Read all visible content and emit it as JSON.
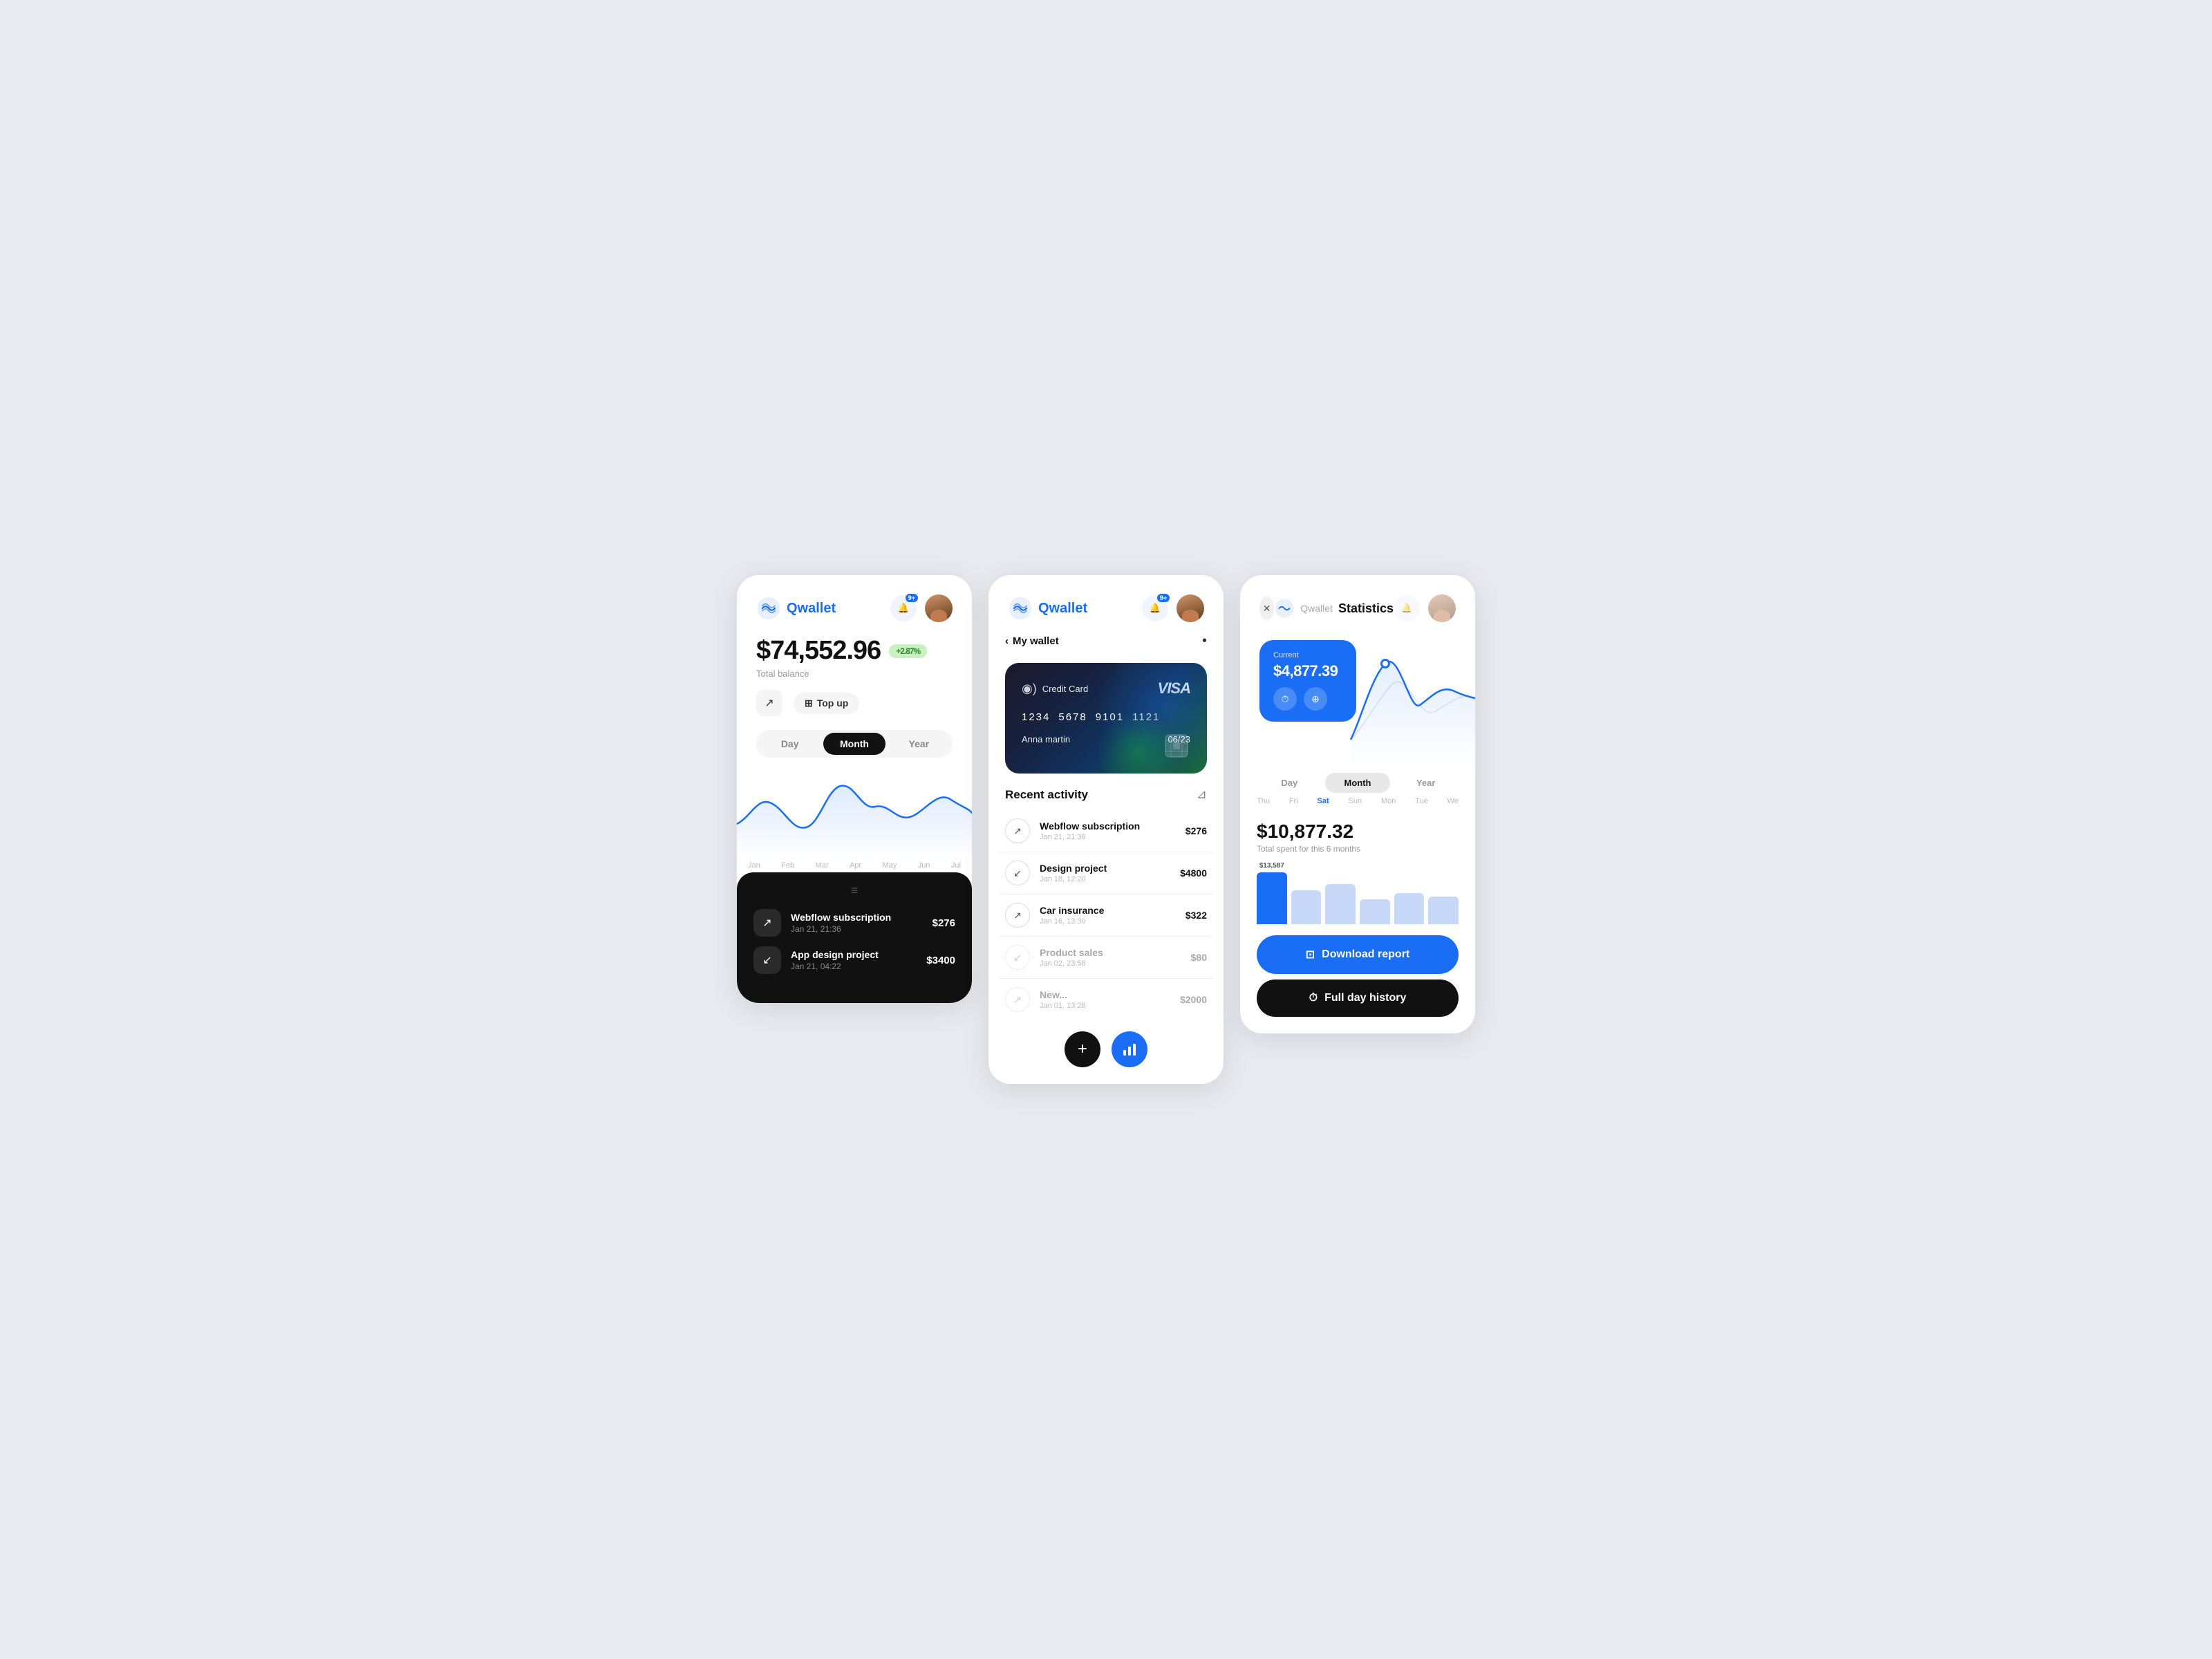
{
  "app": {
    "name": "Qwallet",
    "tagline": "Statistics"
  },
  "screen1": {
    "logo": "Qwallet",
    "notif_badge": "9+",
    "balance": "$74,552.96",
    "balance_label": "Total balance",
    "balance_change": "+2.87%",
    "topup_label": "Top up",
    "periods": [
      "Day",
      "Month",
      "Year"
    ],
    "active_period": "Month",
    "chart_labels": [
      "Jan",
      "Feb",
      "Mar",
      "Apr",
      "May",
      "Jun",
      "Jul"
    ],
    "transactions": [
      {
        "name": "Webflow subscription",
        "date": "Jan 21, 21:36",
        "amount": "$276",
        "direction": "up"
      },
      {
        "name": "App design project",
        "date": "Jan 21, 04:22",
        "amount": "$3400",
        "direction": "down"
      }
    ]
  },
  "screen2": {
    "logo": "Qwallet",
    "back_label": "My wallet",
    "card": {
      "type": "Credit Card",
      "brand": "VISA",
      "number": [
        "1234",
        "5678",
        "9101",
        "1121"
      ],
      "name": "Anna martin",
      "expiry": "06/23"
    },
    "recent_title": "Recent activity",
    "activities": [
      {
        "name": "Webflow subscription",
        "date": "Jan 21, 21:36",
        "amount": "$276",
        "direction": "up",
        "faded": false
      },
      {
        "name": "Design project",
        "date": "Jan 18, 12:20",
        "amount": "$4800",
        "direction": "down",
        "faded": false
      },
      {
        "name": "Car insurance",
        "date": "Jan 16, 13:30",
        "amount": "$322",
        "direction": "up",
        "faded": false
      },
      {
        "name": "Product sales",
        "date": "Jan 02, 23:58",
        "amount": "$80",
        "direction": "down",
        "faded": true
      },
      {
        "name": "New...",
        "date": "Jan 01, 13:28",
        "amount": "$2000",
        "direction": "up",
        "faded": true
      }
    ]
  },
  "screen3": {
    "title": "Statistics",
    "current_label": "Current",
    "current_amount": "$4,877.39",
    "periods": [
      "Day",
      "Month",
      "Year"
    ],
    "active_period": "Month",
    "weekdays": [
      "Thu",
      "Fri",
      "Sat",
      "Sun",
      "Mon",
      "Tue",
      "We"
    ],
    "active_weekday": "Sat",
    "total_amount": "$10,877.32",
    "total_label": "Total spent for this 6 months",
    "top_bar_label": "$13,587",
    "bars": [
      {
        "height": 85,
        "color": "#1a6ef5",
        "label": ""
      },
      {
        "height": 55,
        "color": "#c8d8f8",
        "label": ""
      },
      {
        "height": 65,
        "color": "#c8d8f8",
        "label": ""
      },
      {
        "height": 40,
        "color": "#c8d8f8",
        "label": ""
      },
      {
        "height": 50,
        "color": "#c8d8f8",
        "label": ""
      },
      {
        "height": 45,
        "color": "#c8d8f8",
        "label": ""
      }
    ],
    "download_label": "Download report",
    "history_label": "Full day history"
  }
}
